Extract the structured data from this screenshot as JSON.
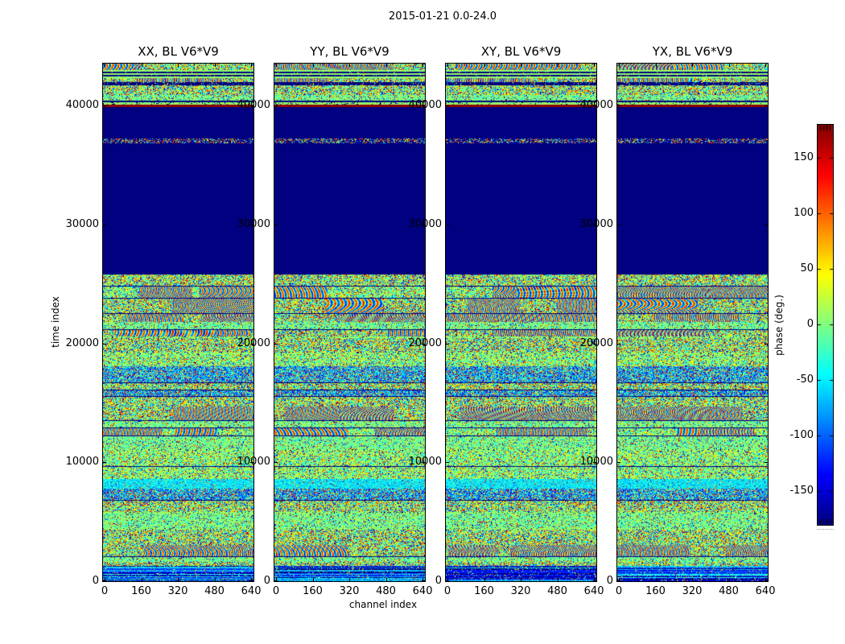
{
  "figure": {
    "title": "2015-01-21 0.0-24.0",
    "background": "#ffffff"
  },
  "chart_data": {
    "type": "heatmap",
    "title": "2015-01-21 0.0-24.0",
    "xlabel": "channel index",
    "ylabel": "time index",
    "xlim": [
      0,
      654
    ],
    "ylim": [
      0,
      43520
    ],
    "xticks": [
      0,
      160,
      320,
      480,
      640
    ],
    "yticks": [
      0,
      10000,
      20000,
      30000,
      40000
    ],
    "colormap": "jet",
    "grid": false,
    "panels": [
      {
        "id": "xx",
        "title": "XX, BL V6*V9",
        "seed": 101
      },
      {
        "id": "yy",
        "title": "YY, BL V6*V9",
        "seed": 202
      },
      {
        "id": "xy",
        "title": "XY, BL V6*V9",
        "seed": 303
      },
      {
        "id": "yx",
        "title": "YX, BL V6*V9",
        "seed": 404
      }
    ],
    "colorbar": {
      "label": "phase (deg.)",
      "clim": [
        -180,
        180
      ],
      "ticks": [
        150,
        100,
        50,
        0,
        -50,
        -100,
        -150
      ],
      "top_color": "#7f0000",
      "bottom_color": "#00007f"
    },
    "colors": {
      "navy": "#00007f",
      "red_line": "#9f0000",
      "pale_green": "#7dff7d"
    },
    "structure_seed": 7,
    "regions": [
      {
        "t0": 43520,
        "t1": 43000,
        "kind": "noise"
      },
      {
        "t0": 43000,
        "t1": 42330,
        "kind": "stripes"
      },
      {
        "t0": 42330,
        "t1": 41990,
        "kind": "noise"
      },
      {
        "t0": 41990,
        "t1": 41690,
        "kind": "navy_speckle"
      },
      {
        "t0": 41690,
        "t1": 40890,
        "kind": "noise"
      },
      {
        "t0": 40890,
        "t1": 40440,
        "kind": "green_speckle"
      },
      {
        "t0": 40440,
        "t1": 40240,
        "kind": "navy"
      },
      {
        "t0": 40240,
        "t1": 40090,
        "kind": "green_row"
      },
      {
        "t0": 40090,
        "t1": 39870,
        "kind": "red_line"
      },
      {
        "t0": 39870,
        "t1": 37230,
        "kind": "navy"
      },
      {
        "t0": 37230,
        "t1": 36830,
        "kind": "noise_sparse"
      },
      {
        "t0": 36830,
        "t1": 25800,
        "kind": "navy"
      },
      {
        "t0": 25800,
        "t1": 8600,
        "kind": "noise_structured"
      },
      {
        "t0": 8600,
        "t1": 7800,
        "kind": "cyan_band"
      },
      {
        "t0": 7800,
        "t1": 1300,
        "kind": "noise_structured"
      },
      {
        "t0": 1300,
        "t1": 0,
        "kind": "blue_streaks"
      }
    ]
  }
}
